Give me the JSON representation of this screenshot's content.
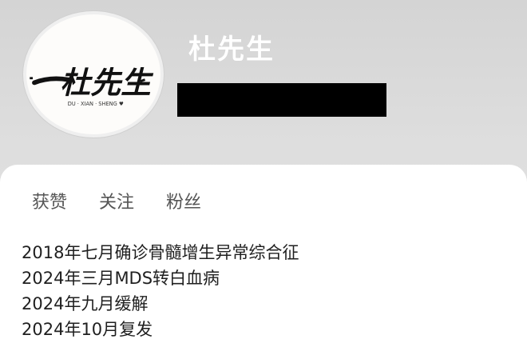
{
  "profile": {
    "avatar_text": "杜先生",
    "avatar_subtext": "DU · XIAN · SHENG ♥",
    "username": "杜先生"
  },
  "stats": {
    "likes_label": "获赞",
    "following_label": "关注",
    "followers_label": "粉丝"
  },
  "bio": {
    "lines": [
      "2018年七月确诊骨髓增生异常综合征",
      "2024年三月MDS转白血病",
      "2024年九月缓解",
      "2024年10月复发"
    ]
  },
  "colors": {
    "background": "#dcdcdc",
    "card": "#ffffff",
    "redaction": "#000000",
    "heart": "#e24a4a"
  }
}
